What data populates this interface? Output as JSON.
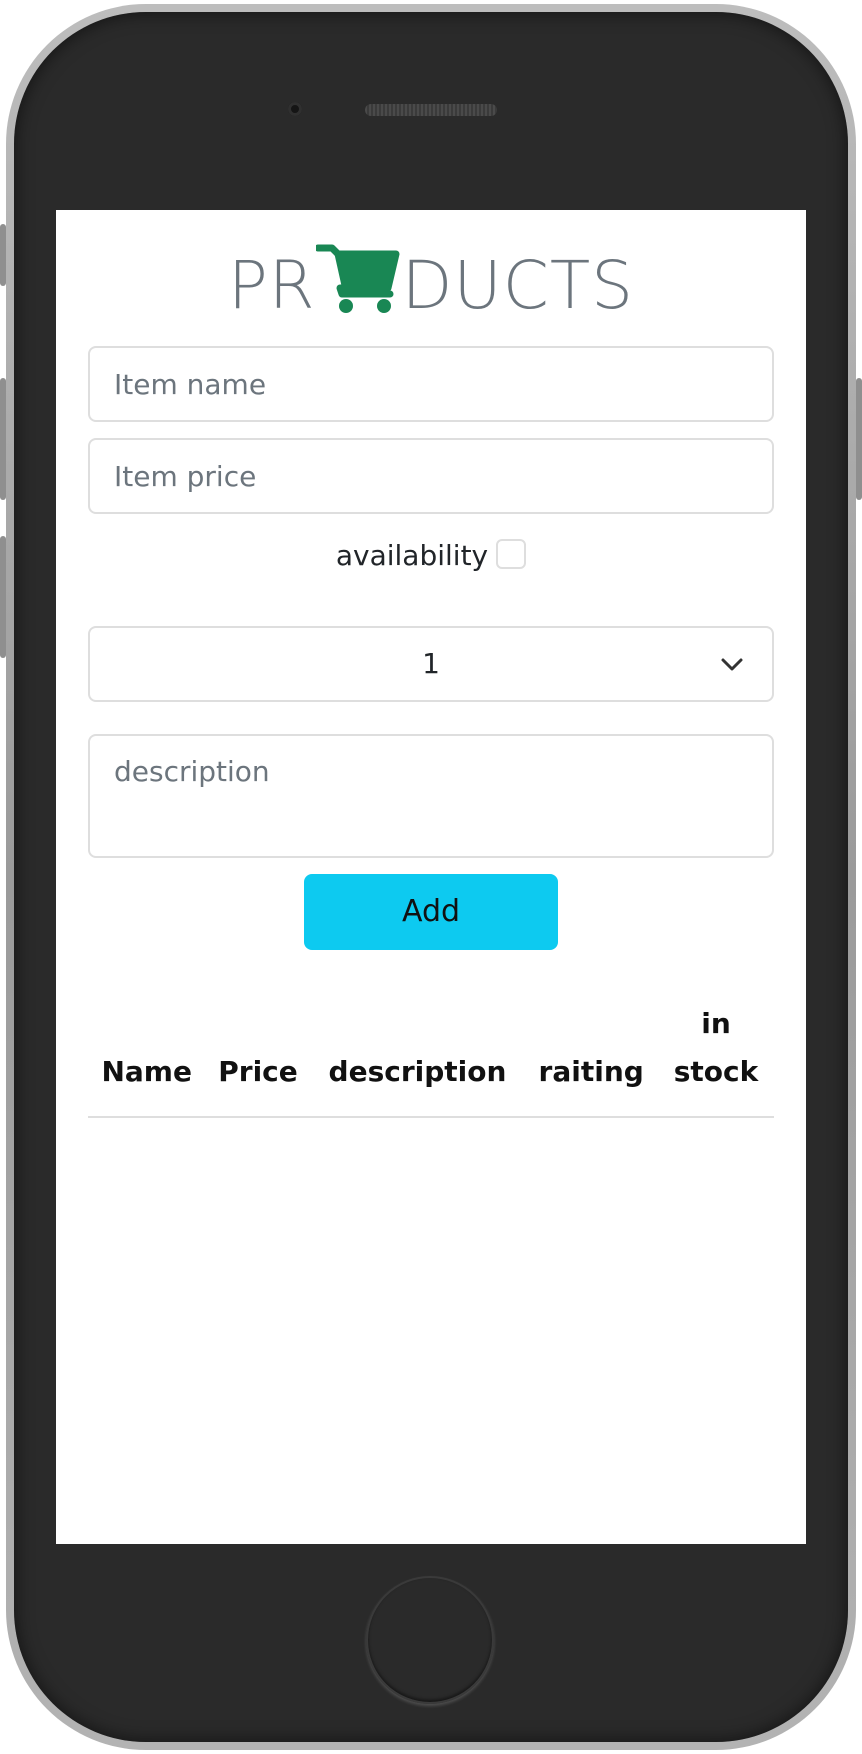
{
  "logo": {
    "left_text": "PR",
    "right_text": "DUCTS",
    "icon": "shopping-cart-icon",
    "icon_color": "#198754",
    "text_color": "#6c757d"
  },
  "form": {
    "item_name_placeholder": "Item name",
    "item_price_placeholder": "Item price",
    "availability_label": "availability",
    "rating_select_value": "1",
    "description_placeholder": "description",
    "add_button_label": "Add",
    "add_button_color": "#0dcaf0"
  },
  "table": {
    "headers": [
      "Name",
      "Price",
      "description",
      "raiting",
      "in stock"
    ]
  }
}
